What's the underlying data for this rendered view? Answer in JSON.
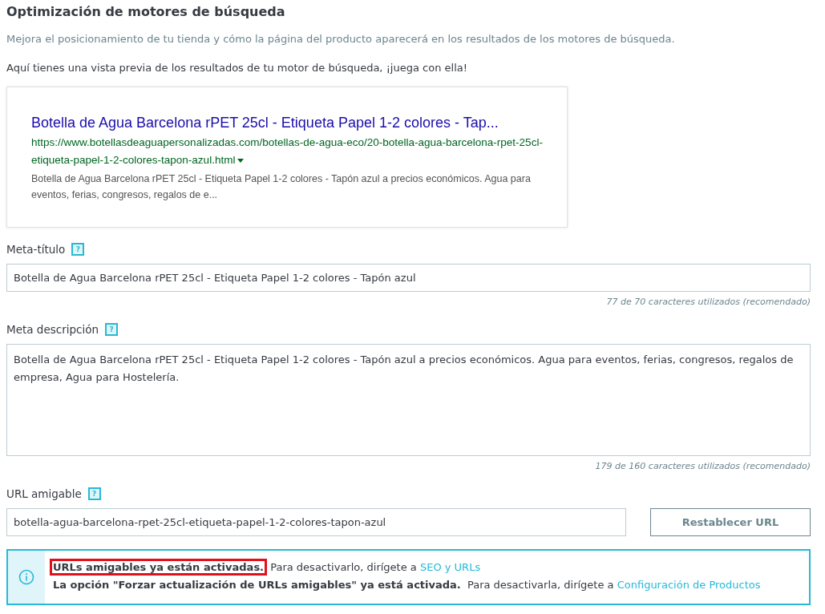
{
  "section": {
    "title": "Optimización de motores de búsqueda",
    "description": "Mejora el posicionamiento de tu tienda y cómo la página del producto aparecerá en los resultados de los motores de búsqueda.",
    "preview_intro": "Aquí tienes una vista previa de los resultados de tu motor de búsqueda, ¡juega con ella!"
  },
  "preview": {
    "title": "Botella de Agua Barcelona rPET 25cl - Etiqueta Papel 1-2 colores - Tap...",
    "url": "https://www.botellasdeaguapersonalizadas.com/botellas-de-agua-eco/20-botella-agua-barcelona-rpet-25cl-etiqueta-papel-1-2-colores-tapon-azul.html",
    "description": "Botella de Agua Barcelona rPET 25cl - Etiqueta Papel 1-2 colores - Tapón azul a precios económicos. Agua para eventos, ferias, congresos, regalos de e..."
  },
  "fields": [
    {
      "kind": "input",
      "label": "Meta-título",
      "help": "?",
      "value": "Botella de Agua Barcelona rPET 25cl - Etiqueta Papel 1-2 colores - Tapón azul",
      "counter": "77 de 70 caracteres utilizados (recomendado)"
    },
    {
      "kind": "textarea",
      "label": "Meta descripción",
      "help": "?",
      "value": "Botella de Agua Barcelona rPET 25cl - Etiqueta Papel 1-2 colores - Tapón azul a precios económicos. Agua para eventos, ferias, congresos, regalos de empresa, Agua para Hostelería.",
      "counter": "179 de 160 caracteres utilizados (recomendado)"
    },
    {
      "kind": "url",
      "label": "URL amigable",
      "help": "?",
      "value": "botella-agua-barcelona-rpet-25cl-etiqueta-papel-1-2-colores-tapon-azul",
      "button": "Restablecer URL"
    }
  ],
  "notice": {
    "lines": [
      {
        "bold": "URLs amigables ya están activadas.",
        "text": "Para desactivarlo, dirígete a",
        "link": "SEO y URLs",
        "highlighted": true
      },
      {
        "bold": "La opción \"Forzar actualización de URLs amigables\" ya está activada.",
        "text": "Para desactivarla, dirígete a",
        "link": "Configuración de Productos",
        "highlighted": false
      }
    ]
  }
}
